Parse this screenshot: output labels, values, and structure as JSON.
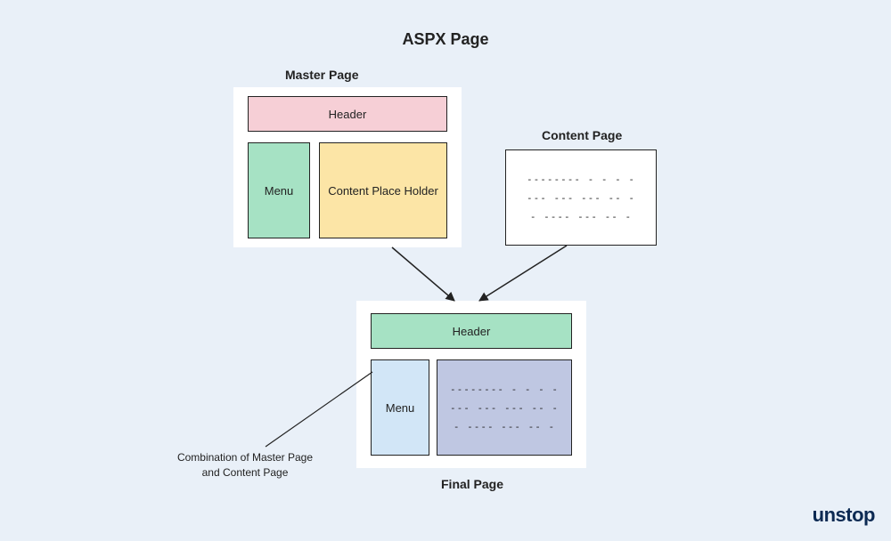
{
  "title": "ASPX Page",
  "master": {
    "label": "Master Page",
    "header": "Header",
    "menu": "Menu",
    "placeholder": "Content Place Holder"
  },
  "content": {
    "label": "Content Page",
    "lines": [
      "-------- - - - -",
      "--- --- --- -- -",
      "- ---- --- -- -"
    ]
  },
  "final": {
    "label": "Final Page",
    "header": "Header",
    "menu": "Menu",
    "lines": [
      "-------- - - - -",
      "--- --- --- -- -",
      "- ---- --- -- -"
    ]
  },
  "annotation": "Combination of Master Page\nand Content Page",
  "logo": "unstop"
}
